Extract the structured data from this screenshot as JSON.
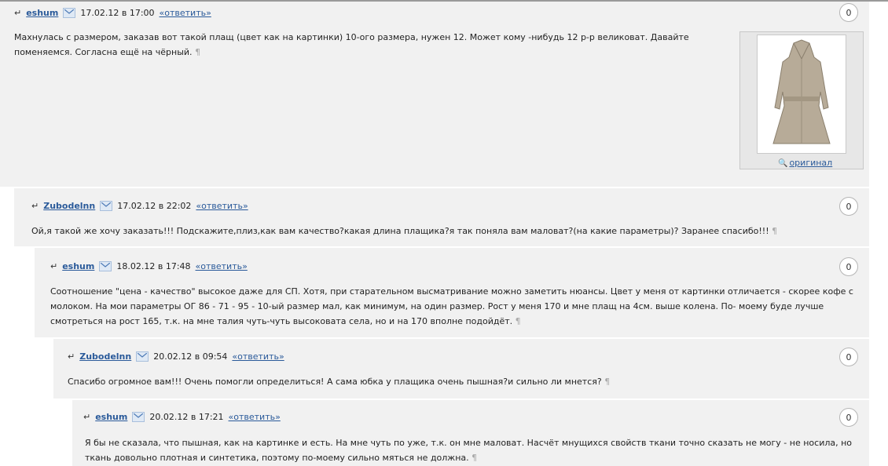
{
  "comments": [
    {
      "author": "eshum",
      "date": "17.02.12 в 17:00",
      "reply": "«ответить»",
      "rating": "0",
      "text": "Махнулась с размером, заказав вот такой плащ (цвет как на картинки) 10-ого размера, нужен 12. Может кому -нибудь 12 р-р великоват. Давайте поменяемся. Согласна ещё на чёрный.",
      "image_link": "оригинал"
    },
    {
      "author": "Zubodelnn",
      "date": "17.02.12 в 22:02",
      "reply": "«ответить»",
      "rating": "0",
      "text": "Ой,я такой же хочу заказать!!! Подскажите,плиз,как вам качество?какая длина плащика?я так поняла вам маловат?(на какие параметры)? Заранее спасибо!!!"
    },
    {
      "author": "eshum",
      "date": "18.02.12 в 17:48",
      "reply": "«ответить»",
      "rating": "0",
      "text": "Соотношение \"цена - качество\" высокое даже для СП. Хотя, при старательном высматривание можно заметить нюансы. Цвет у меня от картинки отличается - скорее кофе с молоком. На мои параметры ОГ 86 - 71 - 95 - 10-ый размер мал, как минимум, на один размер. Рост у меня 170 и мне плащ на 4см. выше колена. По- моему буде лучше смотреться на рост 165, т.к. на мне талия чуть-чуть высоковата села, но и на 170 вполне подойдёт."
    },
    {
      "author": "Zubodelnn",
      "date": "20.02.12 в 09:54",
      "reply": "«ответить»",
      "rating": "0",
      "text": "Спасибо огромное вам!!! Очень помогли определиться! А сама юбка у плащика очень пышная?и сильно ли мнется?"
    },
    {
      "author": "eshum",
      "date": "20.02.12 в 17:21",
      "reply": "«ответить»",
      "rating": "0",
      "text": "Я бы не сказала, что пышная, как на картинке и есть. На мне чуть по уже, т.к. он мне маловат. Насчёт мнущихся свойств ткани точно сказать не могу - не носила, но ткань довольно плотная и синтетика, поэтому по-моему сильно мяться не должна."
    }
  ],
  "pilcrow": "¶",
  "reply_arrow": "↵",
  "colors": {
    "link": "#2a5a9a",
    "panel": "#f1f1f1",
    "coat": "#b7ab98"
  }
}
